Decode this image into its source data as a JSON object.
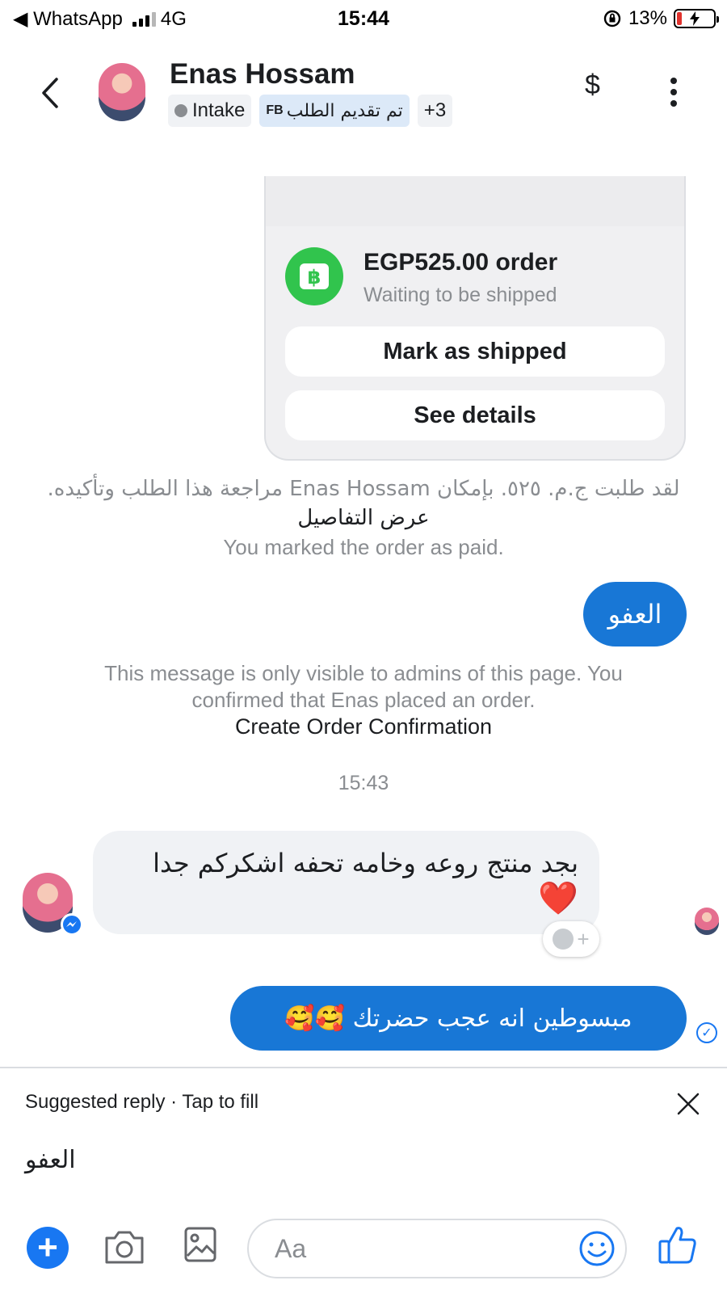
{
  "status_bar": {
    "carrier": "◀ WhatsApp",
    "network": "4G",
    "time": "15:44",
    "battery": "13%"
  },
  "header": {
    "contact_name": "Enas Hossam",
    "tags": {
      "intake": "Intake",
      "fb_prefix": "FB",
      "fb_tag": "تم تقديم الطلب",
      "more": "+3"
    },
    "dollar": "$"
  },
  "order_card": {
    "title": "EGP525.00 order",
    "status": "Waiting to be shipped",
    "mark_shipped": "Mark as shipped",
    "see_details": "See details",
    "icon_color": "#31c44d"
  },
  "messages": {
    "system_arabic": "لقد طلبت ج.م. ٥٢٥. بإمكان Enas Hossam مراجعة هذا الطلب وتأكيده.",
    "view_details_link": "عرض التفاصيل",
    "marked_paid": "You marked the order as paid.",
    "reply_afw": "العفو",
    "admin_notice": "This message is only visible to admins of this page. You confirmed that Enas placed an order.",
    "create_confirmation_link": "Create Order Confirmation",
    "timestamp": "15:43",
    "incoming_text": "بجد منتج روعه وخامه تحفه اشكركم جدا",
    "incoming_emoji": "❤️",
    "outgoing_last": "مبسوطين انه عجب حضرتك 🥰🥰"
  },
  "suggested_reply": {
    "label": "Suggested reply · Tap to fill",
    "text": "العفو"
  },
  "composer": {
    "placeholder": "Aa"
  },
  "colors": {
    "accent": "#1877f2",
    "outgoing_bubble": "#1877d6",
    "incoming_bubble": "#f0f2f5"
  }
}
